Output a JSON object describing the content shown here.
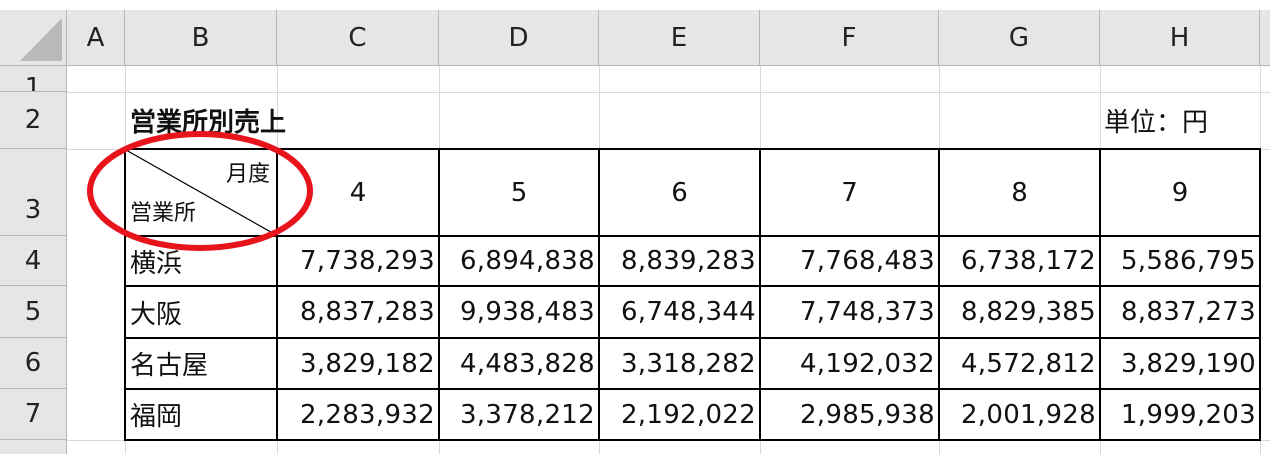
{
  "columns": [
    "A",
    "B",
    "C",
    "D",
    "E",
    "F",
    "G",
    "H"
  ],
  "rows": [
    "1",
    "2",
    "3",
    "4",
    "5",
    "6",
    "7"
  ],
  "title": "営業所別売上",
  "unit": "単位：円",
  "diag_header": {
    "top_right": "月度",
    "bottom_left": "営業所"
  },
  "months": [
    "4",
    "5",
    "6",
    "7",
    "8",
    "9"
  ],
  "table_rows": [
    {
      "office": "横浜",
      "values": [
        "7,738,293",
        "6,894,838",
        "8,839,283",
        "7,768,483",
        "6,738,172",
        "5,586,795"
      ]
    },
    {
      "office": "大阪",
      "values": [
        "8,837,283",
        "9,938,483",
        "6,748,344",
        "7,748,373",
        "8,829,385",
        "8,837,273"
      ]
    },
    {
      "office": "名古屋",
      "values": [
        "3,829,182",
        "4,483,828",
        "3,318,282",
        "4,192,032",
        "4,572,812",
        "3,829,190"
      ]
    },
    {
      "office": "福岡",
      "values": [
        "2,283,932",
        "3,378,212",
        "2,192,022",
        "2,985,938",
        "2,001,928",
        "1,999,203"
      ]
    }
  ],
  "highlight_color": "#e8141b"
}
